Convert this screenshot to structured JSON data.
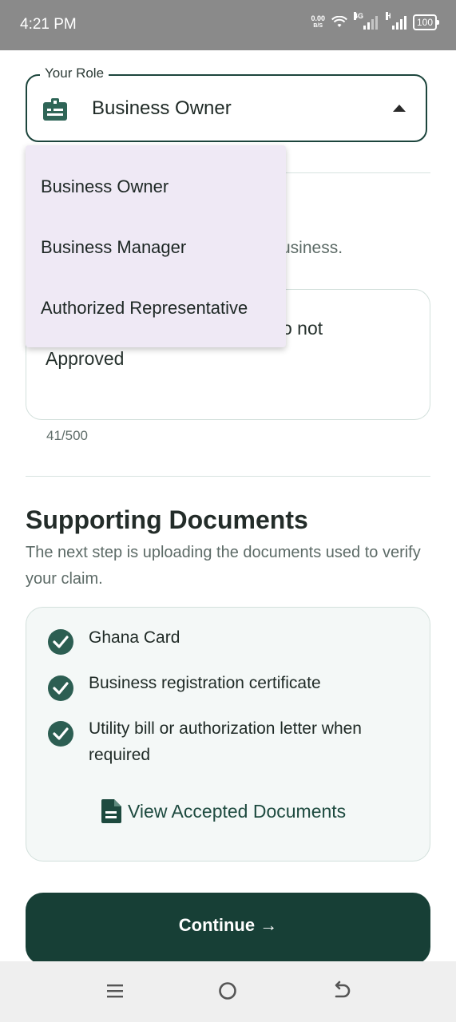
{
  "status_bar": {
    "time": "4:21 PM",
    "net_speed_value": "0.00",
    "net_speed_unit": "B/S",
    "network_type_1": "4G",
    "network_type_2": "H",
    "battery": "100"
  },
  "role_field": {
    "label": "Your Role",
    "value": "Business Owner",
    "icon": "id-badge-icon"
  },
  "dropdown": {
    "options": [
      "Business Owner",
      "Business Manager",
      "Authorized Representative"
    ]
  },
  "background_form": {
    "partial_text_1": "usiness.",
    "description_partial_line": "o not",
    "description_line_2": "Approved",
    "counter": "41/500"
  },
  "supporting_documents": {
    "title": "Supporting Documents",
    "subtitle": "The next step is uploading the documents used to verify your claim.",
    "items": [
      "Ghana Card",
      "Business registration certificate",
      "Utility bill or authorization letter when required"
    ],
    "view_link": "View Accepted Documents"
  },
  "continue_button": "Continue →",
  "colors": {
    "primary_dark": "#173f36",
    "check_green": "#2c5e52",
    "dropdown_bg": "#efe9f5"
  }
}
